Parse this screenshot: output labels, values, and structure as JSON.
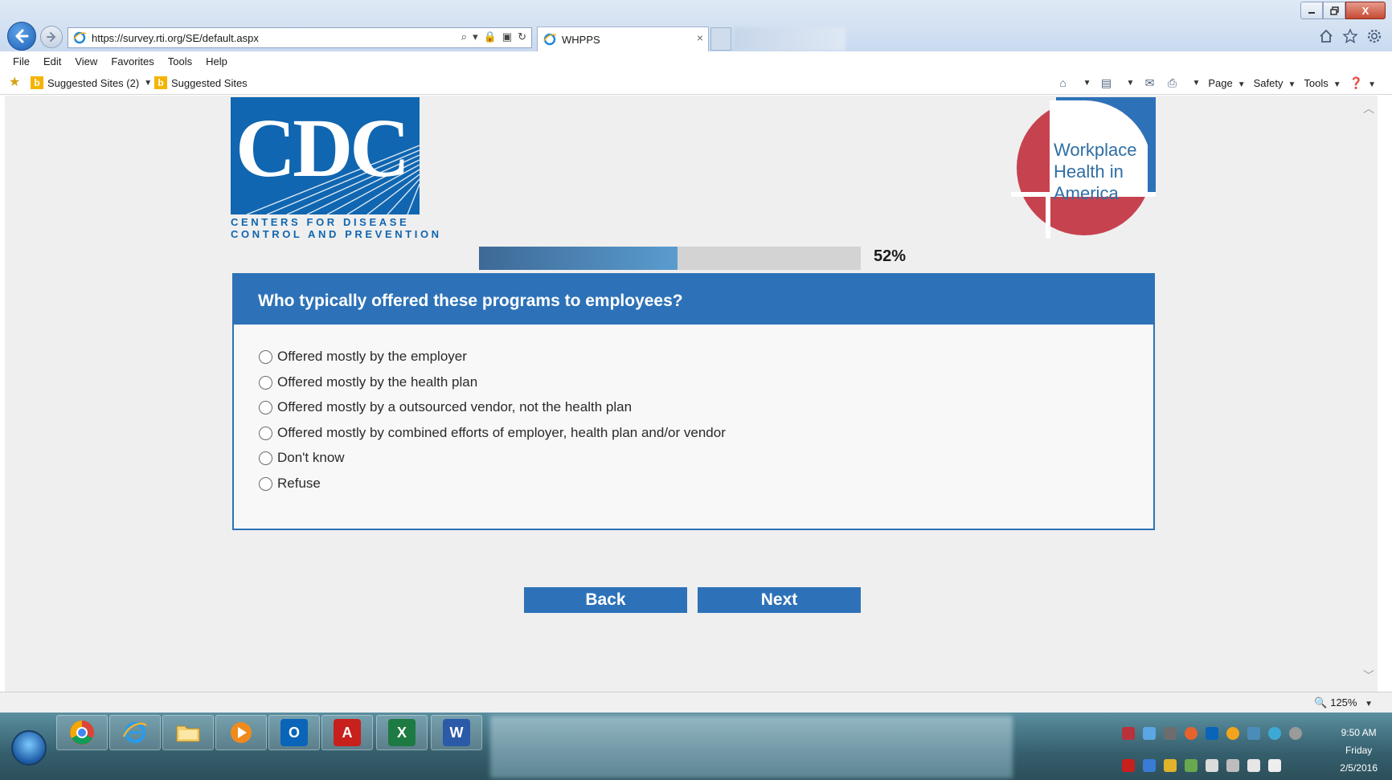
{
  "browser": {
    "url": "https://survey.rti.org/SE/default.aspx",
    "tab_title": "WHPPS",
    "tab_close": "×",
    "menu": [
      "File",
      "Edit",
      "View",
      "Favorites",
      "Tools",
      "Help"
    ],
    "favorites": [
      {
        "label": "Suggested Sites (2)",
        "has_dropdown": true
      },
      {
        "label": "Suggested Sites",
        "has_dropdown": false
      }
    ],
    "command_bar": {
      "page": "Page",
      "safety": "Safety",
      "tools": "Tools"
    },
    "zoom": "125%",
    "window_close": "X"
  },
  "logos": {
    "cdc_letters": "CDC",
    "cdc_line1": "CENTERS FOR DISEASE",
    "cdc_line2": "CONTROL AND PREVENTION",
    "wha_line1": "Workplace",
    "wha_line2": "Health in",
    "wha_line3": "America"
  },
  "progress": {
    "value": 0.52,
    "label": "52%"
  },
  "question": {
    "title": "Who typically offered these programs to employees?",
    "options": [
      "Offered mostly by the employer",
      "Offered mostly by the health plan",
      "Offered mostly by a outsourced vendor, not the health plan",
      "Offered mostly by combined efforts of employer, health plan and/or vendor",
      "Don't know",
      "Refuse"
    ]
  },
  "buttons": {
    "back": "Back",
    "next": "Next"
  },
  "taskbar": {
    "apps": [
      "chrome",
      "internet-explorer",
      "file-explorer",
      "media-player",
      "outlook",
      "acrobat",
      "excel",
      "word"
    ],
    "clock": {
      "time": "9:50 AM",
      "day": "Friday",
      "date": "2/5/2016"
    }
  },
  "colors": {
    "accent_blue": "#2d72b8",
    "cdc_blue": "#1066b0",
    "wha_red": "#c7424f",
    "progress_fill": "#4a82b8"
  }
}
